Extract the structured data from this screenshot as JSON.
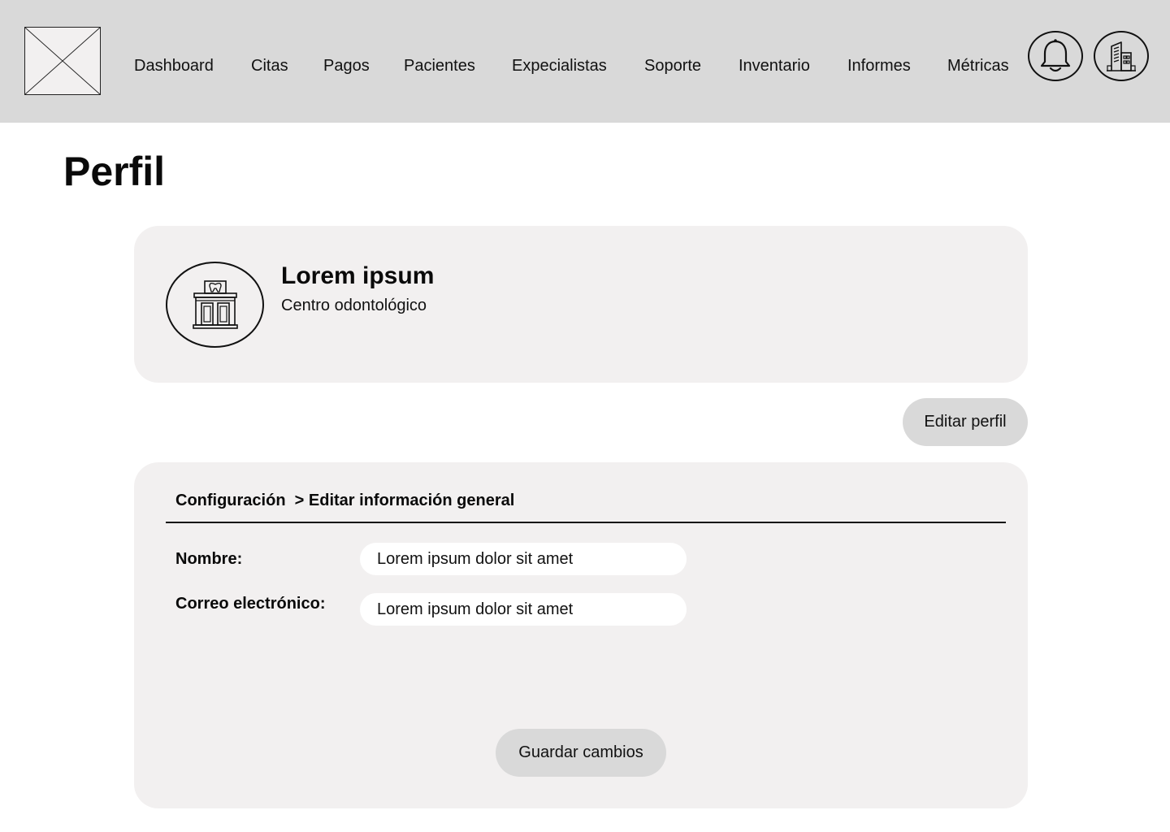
{
  "header": {
    "logo": "image-placeholder",
    "nav": [
      {
        "label": "Dashboard"
      },
      {
        "label": "Citas"
      },
      {
        "label": "Pagos"
      },
      {
        "label": "Pacientes"
      },
      {
        "label": "Expecialistas"
      },
      {
        "label": "Soporte"
      },
      {
        "label": "Inventario"
      },
      {
        "label": "Informes"
      },
      {
        "label": "Métricas"
      }
    ],
    "icons": {
      "notifications": "bell-icon",
      "organization": "buildings-icon"
    }
  },
  "page": {
    "title": "Perfil"
  },
  "profile": {
    "avatar_icon": "dental-clinic-icon",
    "name": "Lorem ipsum",
    "subtitle": "Centro odontológico",
    "edit_label": "Editar perfil"
  },
  "settings": {
    "breadcrumb": {
      "root": "Configuración",
      "current": "> Editar información general"
    },
    "fields": [
      {
        "label": "Nombre:",
        "value": "Lorem ipsum dolor sit amet"
      },
      {
        "label": "Correo electrónico:",
        "value": "Lorem ipsum dolor sit amet"
      }
    ],
    "save_label": "Guardar cambios"
  },
  "colors": {
    "header_bg": "#d9d9d9",
    "card_bg": "#f2f0f0",
    "button_bg": "#d9d9d9",
    "input_bg": "#ffffff",
    "text": "#111111"
  }
}
